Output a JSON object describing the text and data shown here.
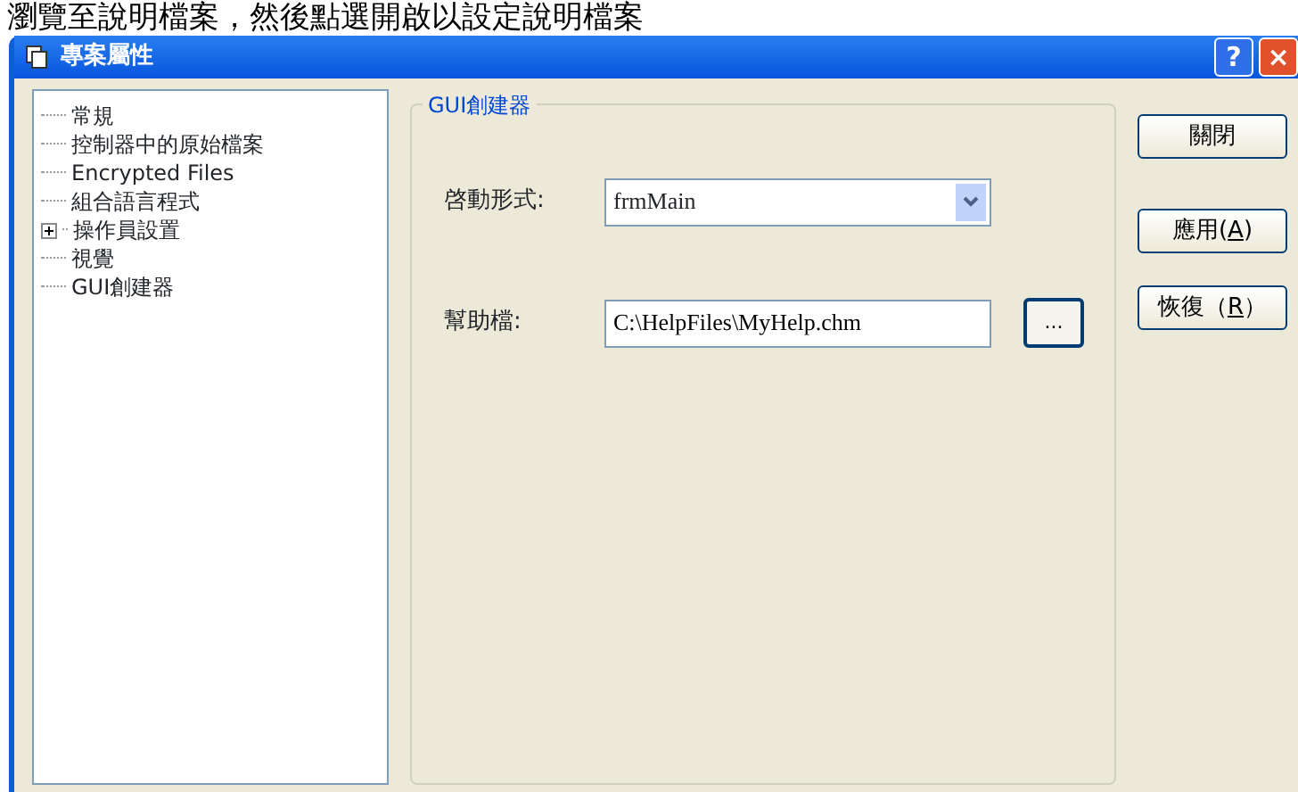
{
  "caption": "瀏覽至說明檔案，然後點選開啟以設定說明檔案",
  "window": {
    "title": "專案屬性",
    "title_buttons": [
      "?",
      "×"
    ]
  },
  "tree": {
    "items": [
      {
        "label": "常規",
        "expandable": false
      },
      {
        "label": "控制器中的原始檔案",
        "expandable": false
      },
      {
        "label": "Encrypted Files",
        "expandable": false
      },
      {
        "label": "組合語言程式",
        "expandable": false
      },
      {
        "label": "操作員設置",
        "expandable": true
      },
      {
        "label": "視覺",
        "expandable": false
      },
      {
        "label": "GUI創建器",
        "expandable": false
      }
    ]
  },
  "group": {
    "title": "GUI創建器",
    "fields": [
      {
        "kind": "dropdown",
        "label": "啓動形式:",
        "value": "frmMain"
      },
      {
        "kind": "file",
        "label": "幫助檔:",
        "value": "C:\\HelpFiles\\MyHelp.chm",
        "button": "..."
      }
    ]
  },
  "buttons": [
    {
      "label": "關閉"
    },
    {
      "label": "應用(",
      "key": "A",
      "tail": ")"
    },
    {
      "label": "恢復（",
      "key": "R",
      "tail": "）"
    }
  ]
}
